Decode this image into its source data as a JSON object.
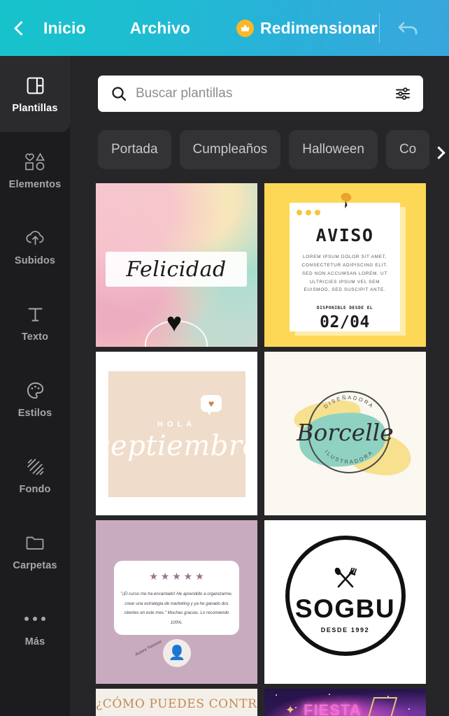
{
  "header": {
    "back_icon": "chevron-left-icon",
    "home_label": "Inicio",
    "file_label": "Archivo",
    "resize_label": "Redimensionar",
    "crown_icon": "crown-icon",
    "undo_icon": "undo-icon",
    "gradient_start": "#17c3cb",
    "gradient_end": "#39a6dd",
    "crown_color": "#f8b829"
  },
  "sidebar": {
    "items": [
      {
        "label": "Plantillas",
        "icon": "templates-icon",
        "active": true
      },
      {
        "label": "Elementos",
        "icon": "shapes-icon",
        "active": false
      },
      {
        "label": "Subidos",
        "icon": "cloud-upload-icon",
        "active": false
      },
      {
        "label": "Texto",
        "icon": "text-icon",
        "active": false
      },
      {
        "label": "Estilos",
        "icon": "palette-icon",
        "active": false
      },
      {
        "label": "Fondo",
        "icon": "background-hatch-icon",
        "active": false
      },
      {
        "label": "Carpetas",
        "icon": "folder-icon",
        "active": false
      },
      {
        "label": "Más",
        "icon": "more-dots-icon",
        "active": false
      }
    ]
  },
  "search": {
    "placeholder": "Buscar plantillas",
    "value": "",
    "search_icon": "search-icon",
    "filter_icon": "filter-sliders-icon"
  },
  "chips": {
    "items": [
      {
        "label": "Portada"
      },
      {
        "label": "Cumpleaños"
      },
      {
        "label": "Halloween"
      },
      {
        "label": "Co"
      }
    ],
    "scroll_icon": "chevron-right-icon"
  },
  "templates": [
    {
      "name": "felicidad-watercolor",
      "word": "Felicidad",
      "heart_icon": "heart-icon"
    },
    {
      "name": "aviso-note",
      "title": "AVISO",
      "body": "Lorem ipsum dolor sit amet, consectetur adipiscing elit. Sed non accumsan lorem. Ut ultricies ipsum vel sem euismod, sed suscipit ante.",
      "subtitle": "DISPONIBLE DESDE EL",
      "date": "02/04",
      "pin_icon": "pushpin-icon",
      "background": "#fcd856"
    },
    {
      "name": "hola-septiembre",
      "kicker": "HOLA",
      "word": "septiembre",
      "bubble_icon": "heart-speech-bubble-icon"
    },
    {
      "name": "borcelle-logo",
      "word": "Borcelle",
      "arc_top": "DISEÑADORA",
      "arc_bottom": "ILUSTRADORA",
      "teal": "#8fd2c2",
      "yellow": "#f7e08e"
    },
    {
      "name": "testimonio-card",
      "stars": "★ ★ ★ ★ ★",
      "quote": "\"¡El curso me ha encantado! He aprendido a organizarme, crear una estrategia de marketing y ya he ganado dos clientes en este mes.\" Muchas gracias. Lo recomiendo 100%.",
      "signature": "Autora Tomossi",
      "avatar_icon": "person-avatar-icon",
      "background": "#c9abbf"
    },
    {
      "name": "sogbu-logo",
      "word": "SOGBU",
      "tagline": "DESDE 1992",
      "utensils_icon": "spoon-fork-crossed-icon"
    },
    {
      "name": "como-controlar",
      "title": "¿CÓMO PUEDES CONTROLAR"
    },
    {
      "name": "fiesta-neon",
      "word": "FIESTA",
      "star_icon": "sparkle-icon",
      "neon_color": "#f06fd4"
    }
  ]
}
